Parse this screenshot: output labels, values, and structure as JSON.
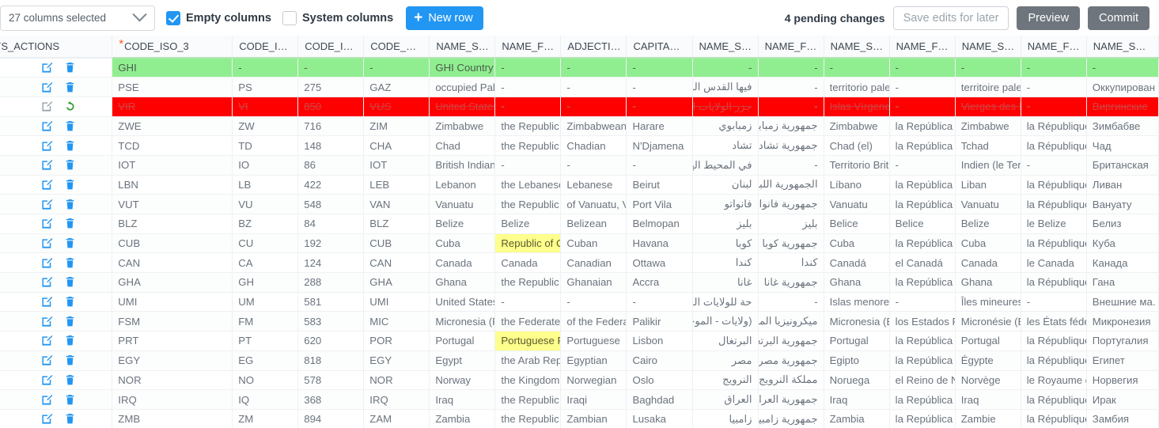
{
  "toolbar": {
    "column_select_label": "27 columns selected",
    "chevron_icon": "chevron-down-icon",
    "empty_columns_label": "Empty columns",
    "empty_columns_checked": true,
    "system_columns_label": "System columns",
    "system_columns_checked": false,
    "new_row_label": "New row",
    "new_row_icon": "plus-icon",
    "pending_changes": "4 pending changes",
    "save_edits_label": "Save edits for later",
    "preview_label": "Preview",
    "commit_label": "Commit",
    "accent_color": "#2196f3",
    "button_grey_color": "#6e757c"
  },
  "grid": {
    "columns": [
      {
        "key": "actions",
        "label": "SYS_ACTIONS",
        "width": 140,
        "required": false
      },
      {
        "key": "code_iso_3",
        "label": "CODE_ISO_3",
        "width": 150,
        "required": true
      },
      {
        "key": "code_i_a",
        "label": "CODE_I…",
        "width": 82,
        "required": false
      },
      {
        "key": "code_i_b",
        "label": "CODE_I…",
        "width": 82,
        "required": false
      },
      {
        "key": "code_c",
        "label": "CODE_…",
        "width": 82,
        "required": false
      },
      {
        "key": "name_s1",
        "label": "NAME_S…",
        "width": 82,
        "required": false
      },
      {
        "key": "name_f1",
        "label": "NAME_F…",
        "width": 82,
        "required": false
      },
      {
        "key": "adjective",
        "label": "ADJECTI…",
        "width": 82,
        "required": false
      },
      {
        "key": "capital",
        "label": "CAPITA…",
        "width": 82,
        "required": false
      },
      {
        "key": "name_s_ar",
        "label": "NAME_S…",
        "width": 82,
        "required": false
      },
      {
        "key": "name_f_ar",
        "label": "NAME_F…",
        "width": 82,
        "required": false
      },
      {
        "key": "name_s_es",
        "label": "NAME_S…",
        "width": 82,
        "required": false
      },
      {
        "key": "name_f_es",
        "label": "NAME_F…",
        "width": 82,
        "required": false
      },
      {
        "key": "name_s_fr",
        "label": "NAME_S…",
        "width": 82,
        "required": false
      },
      {
        "key": "name_f_fr",
        "label": "NAME_F…",
        "width": 82,
        "required": false
      },
      {
        "key": "name_s_ru",
        "label": "NAME_S…",
        "width": 90,
        "required": false
      }
    ],
    "edit_icon": "edit-pencil-icon",
    "delete_icon": "trash-icon",
    "undo_icon": "undo-arrow-icon",
    "colors": {
      "new_row": "#90ee90",
      "deleted_row": "#ff0000",
      "edited_cell": "#ffff8d"
    },
    "rows": [
      {
        "state": "new",
        "actions": [
          "edit-pencil-icon",
          "trash-icon"
        ],
        "cells": [
          "GHI",
          "-",
          "-",
          "-",
          "GHI Country",
          "-",
          "-",
          "-",
          "-",
          "-",
          "-",
          "-",
          "-",
          "-",
          "-"
        ]
      },
      {
        "state": "normal",
        "actions": [
          "edit-pencil-icon",
          "trash-icon"
        ],
        "cells": [
          "PSE",
          "PS",
          "275",
          "GAZ",
          "occupied Pal",
          "-",
          "-",
          "-",
          "فيها القدس الشرقية",
          "-",
          "territorio pale",
          "-",
          "territoire pale",
          "-",
          "Оккупирован"
        ]
      },
      {
        "state": "deleted",
        "actions": [
          "edit-pencil-icon",
          "undo-arrow-icon"
        ],
        "cells": [
          "VIR",
          "VI",
          "850",
          "VUS",
          "United States",
          "-",
          "-",
          "-",
          "جزر الولايات المتحدة",
          "-",
          "Islas Vírgenes",
          "-",
          "Vierges des Ét",
          "-",
          "Виргинские"
        ]
      },
      {
        "state": "normal",
        "actions": [
          "edit-pencil-icon",
          "trash-icon"
        ],
        "cells": [
          "ZWE",
          "ZW",
          "716",
          "ZIM",
          "Zimbabwe",
          "the Republic",
          "Zimbabwean",
          "Harare",
          "زمبابوي",
          "جمهورية زمبابوي",
          "Zimbabwe",
          "la República ",
          "Zimbabwe",
          "la République",
          "Зимбабве"
        ]
      },
      {
        "state": "normal",
        "actions": [
          "edit-pencil-icon",
          "trash-icon"
        ],
        "cells": [
          "TCD",
          "TD",
          "148",
          "CHA",
          "Chad",
          "the Republic",
          "Chadian",
          "N'Djamena",
          "تشاد",
          "جمهورية تشاد",
          "Chad (el)",
          "la República ",
          "Tchad",
          "la République",
          "Чад"
        ]
      },
      {
        "state": "normal",
        "actions": [
          "edit-pencil-icon",
          "trash-icon"
        ],
        "cells": [
          "IOT",
          "IO",
          "86",
          "IOT",
          "British Indian",
          "-",
          "-",
          "-",
          "في المحيط الهندي ,",
          "-",
          "Territorio Brita",
          "-",
          "Indien (le Terr",
          "-",
          "Британская "
        ]
      },
      {
        "state": "normal",
        "actions": [
          "edit-pencil-icon",
          "trash-icon"
        ],
        "cells": [
          "LBN",
          "LB",
          "422",
          "LEB",
          "Lebanon",
          "the Lebanese",
          "Lebanese",
          "Beirut",
          "لبنان",
          "الجمهورية اللبنانية",
          "Líbano",
          "la República l",
          "Liban",
          "la République",
          "Ливан"
        ]
      },
      {
        "state": "normal",
        "actions": [
          "edit-pencil-icon",
          "trash-icon"
        ],
        "cells": [
          "VUT",
          "VU",
          "548",
          "VAN",
          "Vanuatu",
          "the Republic",
          "of Vanuatu, V",
          "Port Vila",
          "فانواتو",
          "جمهورية فانواتو",
          "Vanuatu",
          "la República ",
          "Vanuatu",
          "la République",
          "Вануату"
        ]
      },
      {
        "state": "normal",
        "actions": [
          "edit-pencil-icon",
          "trash-icon"
        ],
        "cells": [
          "BLZ",
          "BZ",
          "84",
          "BLZ",
          "Belize",
          "Belize",
          "Belizean",
          "Belmopan",
          "بليز",
          "بليز",
          "Belice",
          "Belice",
          "Belize",
          "le Belize",
          "Белиз"
        ]
      },
      {
        "state": "normal",
        "edited_cell_index": 5,
        "actions": [
          "edit-pencil-icon",
          "trash-icon"
        ],
        "cells": [
          "CUB",
          "CU",
          "192",
          "CUB",
          "Cuba",
          "Republic of C",
          "Cuban",
          "Havana",
          "كوبا",
          "جمهورية كوبا",
          "Cuba",
          "la República ",
          "Cuba",
          "la République",
          "Куба"
        ]
      },
      {
        "state": "normal",
        "actions": [
          "edit-pencil-icon",
          "trash-icon"
        ],
        "cells": [
          "CAN",
          "CA",
          "124",
          "CAN",
          "Canada",
          "Canada",
          "Canadian",
          "Ottawa",
          "كندا",
          "كندا",
          "Canadá",
          "el Canadá",
          "Canada",
          "le Canada",
          "Канада"
        ]
      },
      {
        "state": "normal",
        "actions": [
          "edit-pencil-icon",
          "trash-icon"
        ],
        "cells": [
          "GHA",
          "GH",
          "288",
          "GHA",
          "Ghana",
          "the Republic",
          "Ghanaian",
          "Accra",
          "غانا",
          "جمهورية غانا",
          "Ghana",
          "la República ",
          "Ghana",
          "la République",
          "Гана"
        ]
      },
      {
        "state": "normal",
        "actions": [
          "edit-pencil-icon",
          "trash-icon"
        ],
        "cells": [
          "UMI",
          "UM",
          "581",
          "UMI",
          "United States",
          "-",
          "-",
          "-",
          "حة للولايات المتحدة",
          "-",
          "Islas menores",
          "-",
          "Îles mineures",
          "-",
          "Внешние ма."
        ]
      },
      {
        "state": "normal",
        "actions": [
          "edit-pencil-icon",
          "trash-icon"
        ],
        "cells": [
          "FSM",
          "FM",
          "583",
          "MIC",
          "Micronesia (F",
          "the Federated",
          "of the Federa",
          "Palikir",
          "(ولايات - الموحدة)",
          "ميكرونيزيا الموحدة",
          "Micronesia (E",
          "los Estados F",
          "Micronésie (É",
          "les États fédé",
          "Микронезия"
        ]
      },
      {
        "state": "normal",
        "edited_cell_index": 5,
        "actions": [
          "edit-pencil-icon",
          "trash-icon"
        ],
        "cells": [
          "PRT",
          "PT",
          "620",
          "POR",
          "Portugal",
          "Portuguese R",
          "Portuguese",
          "Lisbon",
          "البرتغال",
          "جمهورية البرتغال",
          "Portugal",
          "la República l",
          "Portugal",
          "la République",
          "Португалия"
        ]
      },
      {
        "state": "normal",
        "actions": [
          "edit-pencil-icon",
          "trash-icon"
        ],
        "cells": [
          "EGY",
          "EG",
          "818",
          "EGY",
          "Egypt",
          "the Arab Rep",
          "Egyptian",
          "Cairo",
          "مصر",
          "جمهورية مصر العربية",
          "Egipto",
          "la República ,",
          "Égypte",
          "la République",
          "Египет"
        ]
      },
      {
        "state": "normal",
        "actions": [
          "edit-pencil-icon",
          "trash-icon"
        ],
        "cells": [
          "NOR",
          "NO",
          "578",
          "NOR",
          "Norway",
          "the Kingdom",
          "Norwegian",
          "Oslo",
          "النرويج",
          "مملكة النرويج",
          "Noruega",
          "el Reino de N",
          "Norvège",
          "le Royaume d",
          "Норвегия"
        ]
      },
      {
        "state": "normal",
        "actions": [
          "edit-pencil-icon",
          "trash-icon"
        ],
        "cells": [
          "IRQ",
          "IQ",
          "368",
          "IRQ",
          "Iraq",
          "the Republic",
          "Iraqi",
          "Baghdad",
          "العراق",
          "جمهورية العراق",
          "Iraq",
          "la República ",
          "Iraq",
          "la République",
          "Ирак"
        ]
      },
      {
        "state": "normal",
        "actions": [
          "edit-pencil-icon",
          "trash-icon"
        ],
        "cells": [
          "ZMB",
          "ZM",
          "894",
          "ZAM",
          "Zambia",
          "the Republic",
          "Zambian",
          "Lusaka",
          "زامبيا",
          "جمهورية زامبيا",
          "Zambia",
          "la República ",
          "Zambie",
          "la République",
          "Замбия"
        ]
      }
    ]
  }
}
